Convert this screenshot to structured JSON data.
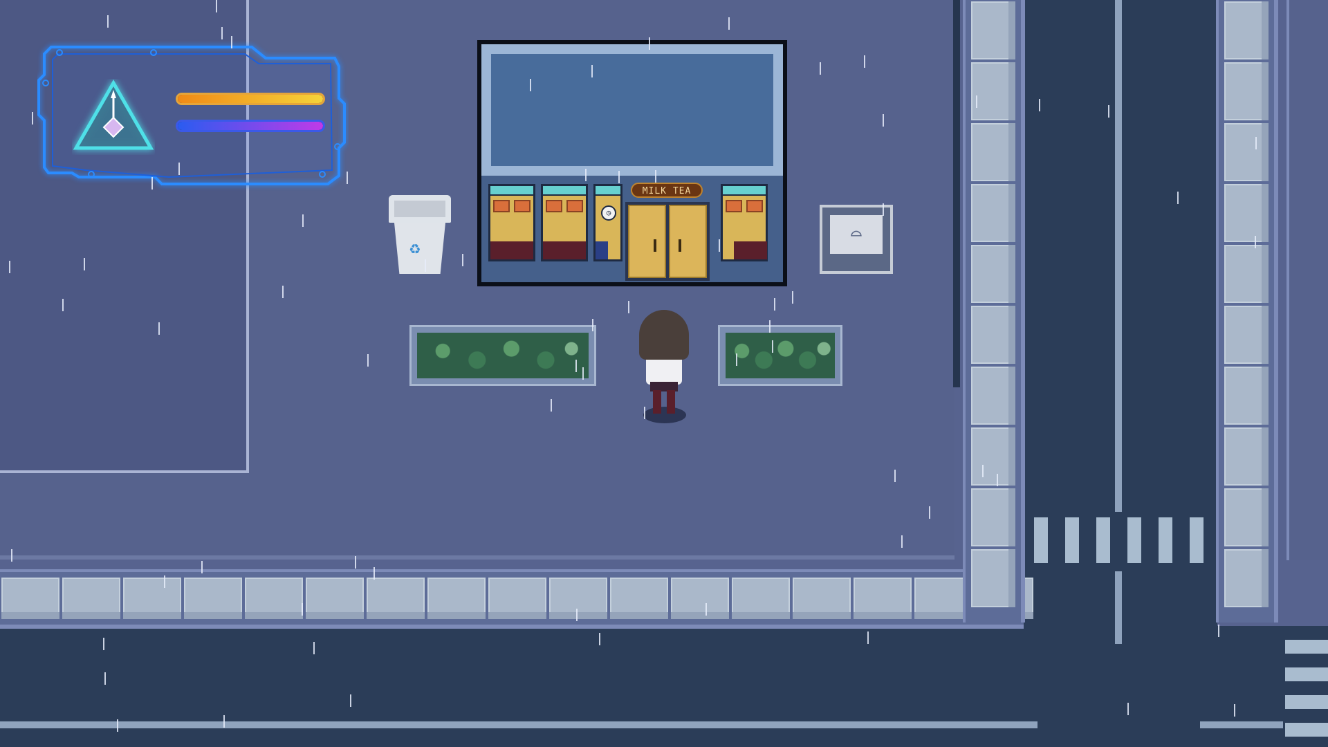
{
  "game": {
    "shop_sign": "MILK TEA",
    "player": {
      "health_fraction": 1.0,
      "energy_fraction": 1.0
    }
  },
  "icons": {
    "hud_emblem": "triangle-crystal-icon",
    "trash": "recycle-icon",
    "billboard": "bench-icon",
    "clock": "clock-icon"
  },
  "colors": {
    "health_bar": "#f5c23a",
    "energy_bar": "#b63ae8",
    "hud_frame": "#2b8cff"
  }
}
